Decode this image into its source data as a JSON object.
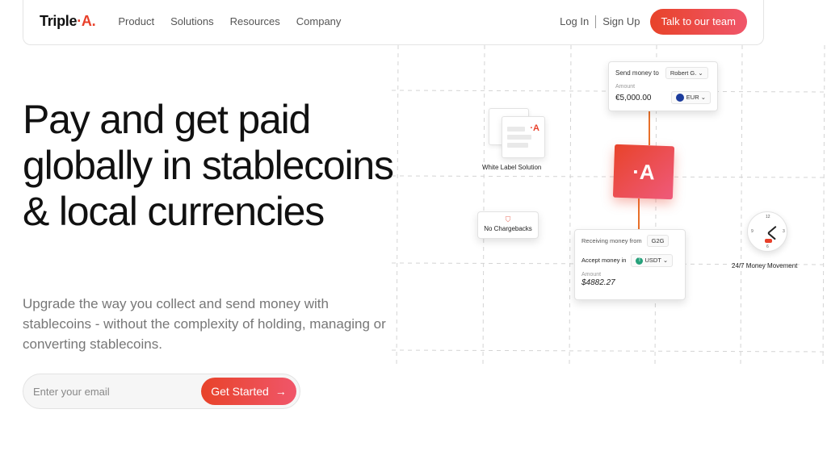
{
  "nav": {
    "logo": "Triple",
    "logo_dot": "·A.",
    "links": [
      "Product",
      "Solutions",
      "Resources",
      "Company"
    ],
    "login": "Log In",
    "signup": "Sign Up",
    "cta": "Talk to our team"
  },
  "hero": {
    "title": "Pay and get paid globally in stablecoins & local currencies",
    "subtitle": "Upgrade the way you collect and send money with stablecoins - without the complexity of holding, managing or converting stablecoins.",
    "email_placeholder": "Enter your email",
    "get_started": "Get Started",
    "arrow": "→"
  },
  "illustration": {
    "send": {
      "label": "Send money to",
      "recipient": "Robert G.",
      "amount_label": "Amount",
      "amount": "€5,000.00",
      "currency": "EUR"
    },
    "brand_mark": "·A",
    "white_label": {
      "mark": "·A",
      "label": "White Label Solution"
    },
    "no_chargebacks": "No Chargebacks",
    "receive": {
      "label": "Receiving money from",
      "sender": "G2G",
      "accept_label": "Accept money in",
      "currency": "USDT",
      "amount_label": "Amount",
      "amount": "$4882.27"
    },
    "clock": {
      "numbers": [
        "12",
        "3",
        "6",
        "9"
      ],
      "label": "24/7 Money Movement"
    }
  },
  "colors": {
    "accent_start": "#e8432a",
    "accent_end": "#f0566a",
    "text_dark": "#111111",
    "text_muted": "#777777"
  }
}
